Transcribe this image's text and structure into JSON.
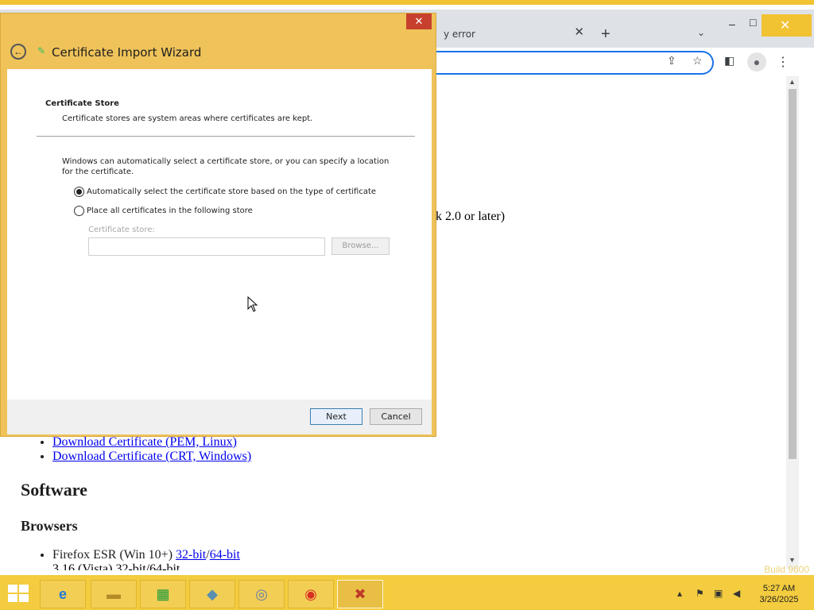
{
  "desktop": {
    "watermark": "Build 9600"
  },
  "chrome": {
    "tab_title": "y error",
    "tab_close": "✕",
    "new_tab": "+",
    "tab_search": "⌄",
    "minimize": "–",
    "maximize": "□",
    "close": "✕"
  },
  "page": {
    "partial_text": "k 2.0 or later)",
    "download_links": [
      "Download Certificate (PEM, Linux)",
      "Download Certificate (CRT, Windows)"
    ],
    "software_heading": "Software",
    "browsers_heading": "Browsers",
    "firefox_prefix": "Firefox ESR (Win 10+) ",
    "firefox_32": "32-bit",
    "firefox_sep": "/",
    "firefox_64": "64-bit",
    "partial_next": "3.16 (Vista) 32-bit/64-bit"
  },
  "wizard": {
    "title": "Certificate Import Wizard",
    "close": "✕",
    "section_title": "Certificate Store",
    "section_desc": "Certificate stores are system areas where certificates are kept.",
    "intro": "Windows can automatically select a certificate store, or you can specify a location for the certificate.",
    "radio_auto_label": "Automatically select the certificate store based on the type of certificate",
    "radio_auto_checked": true,
    "radio_place_label": "Place all certificates in the following store",
    "radio_place_checked": false,
    "store_label": "Certificate store:",
    "store_value": "",
    "browse_label": "Browse...",
    "next_label": "Next",
    "cancel_label": "Cancel"
  },
  "taskbar": {
    "items": [
      "ie-icon",
      "file-explorer-icon",
      "store-icon",
      "wizard-icon",
      "media-icon",
      "chrome-icon",
      "certificate-icon"
    ],
    "active_item": "certificate-icon",
    "time": "5:27 AM",
    "date": "3/26/2025"
  },
  "colors": {
    "accent": "#f3cc3f",
    "link": "#0000ee",
    "omnibox_focus": "#1a73e8"
  }
}
